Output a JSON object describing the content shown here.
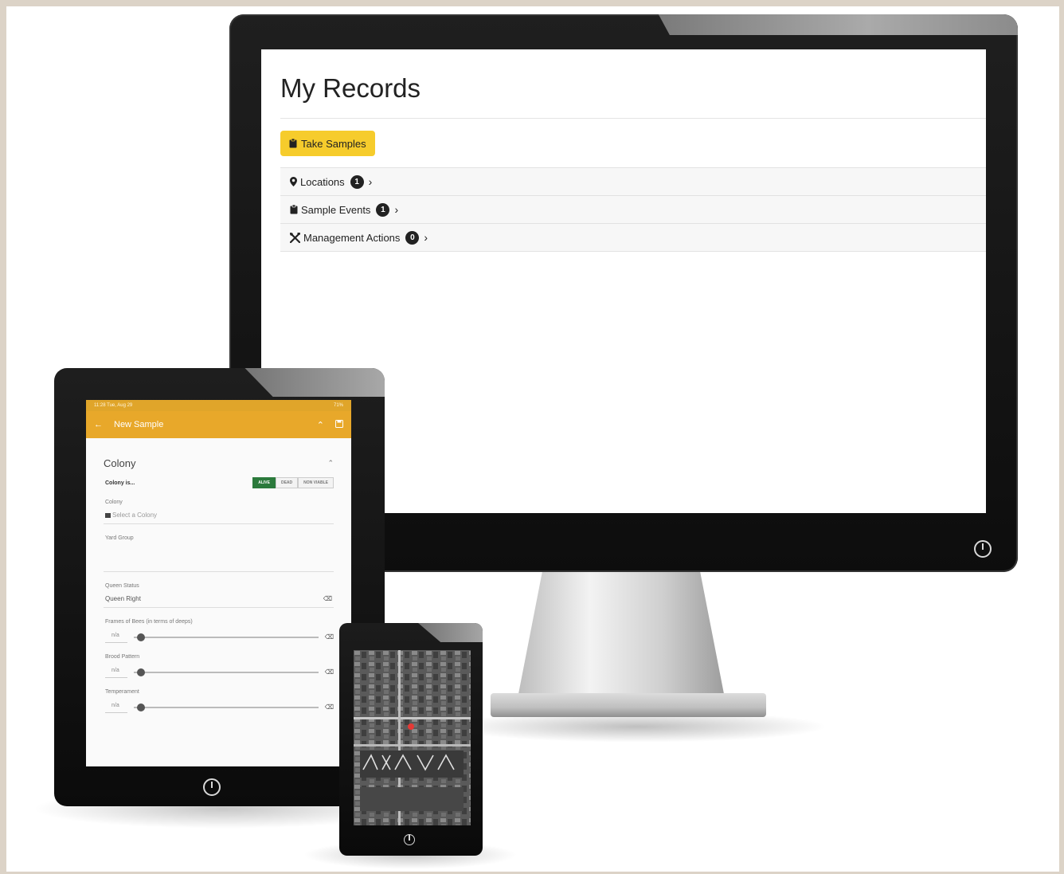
{
  "desktop": {
    "page_title": "My Records",
    "take_samples_label": "Take Samples",
    "records": [
      {
        "label": "Locations",
        "count": "1",
        "icon": "map-pin-icon"
      },
      {
        "label": "Sample Events",
        "count": "1",
        "icon": "clipboard-icon"
      },
      {
        "label": "Management Actions",
        "count": "0",
        "icon": "tools-icon"
      }
    ],
    "accent_color": "#f6cc2c"
  },
  "tablet": {
    "status_left": "11:28 Tue, Aug 29",
    "status_right": "71%",
    "app_title": "New Sample",
    "section_title": "Colony",
    "colony_is_label": "Colony is...",
    "status_options": [
      "ALIVE",
      "DEAD",
      "NON VIABLE"
    ],
    "selected_status": "ALIVE",
    "colony_label": "Colony",
    "colony_placeholder": "Select a Colony",
    "yard_group_label": "Yard Group",
    "queen_status_label": "Queen Status",
    "queen_status_value": "Queen Right",
    "sliders": [
      {
        "label": "Frames of Bees (in terms of deeps)",
        "value": "n/a"
      },
      {
        "label": "Brood Pattern",
        "value": "n/a"
      },
      {
        "label": "Temperament",
        "value": "n/a"
      }
    ],
    "accent_color": "#e8a82a",
    "active_color": "#2b7a3c"
  },
  "phone": {
    "map_type": "satellite",
    "marker_color": "#e53935"
  }
}
